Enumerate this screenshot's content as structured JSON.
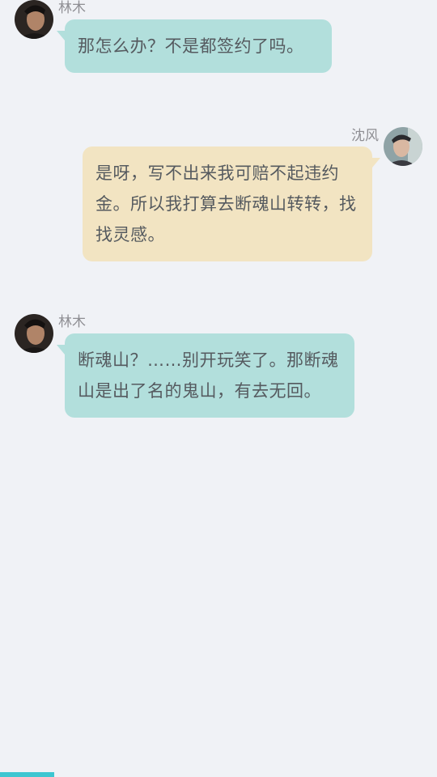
{
  "messages": [
    {
      "sender": "林木",
      "side": "left",
      "text": "那怎么办？不是都签约了吗。",
      "avatar": "avatar-linmu"
    },
    {
      "sender": "沈风",
      "side": "right",
      "text": "是呀，写不出来我可赔不起违约金。所以我打算去断魂山转转，找找灵感。",
      "avatar": "avatar-shenfeng"
    },
    {
      "sender": "林木",
      "side": "left",
      "text": "断魂山？……别开玩笑了。那断魂山是出了名的鬼山，有去无回。",
      "avatar": "avatar-linmu"
    }
  ],
  "progress": {
    "value": 0.124
  },
  "colors": {
    "background": "#f0f2f6",
    "left_bubble": "#b2dfdc",
    "right_bubble": "#f2e4c2",
    "text": "#555a5f",
    "name": "#8e8e93",
    "progress": "#3dc6d1"
  }
}
